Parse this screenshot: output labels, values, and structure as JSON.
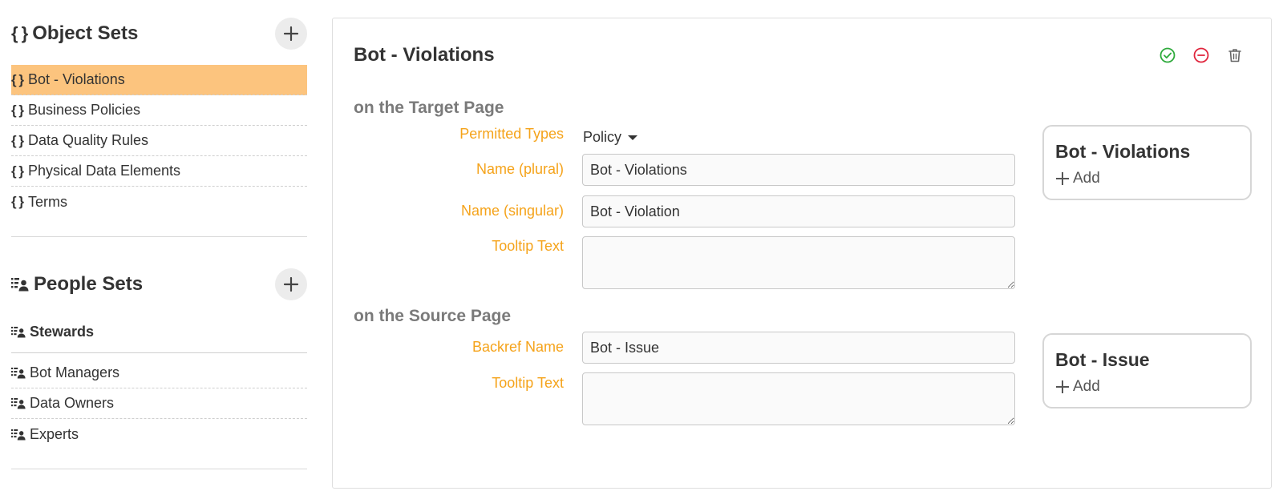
{
  "object_sets": {
    "title": "Object Sets",
    "title_glyph": "{ }",
    "items": [
      {
        "label": "Bot - Violations",
        "selected": true
      },
      {
        "label": "Business Policies"
      },
      {
        "label": "Data Quality Rules"
      },
      {
        "label": "Physical Data Elements"
      },
      {
        "label": "Terms"
      }
    ]
  },
  "people_sets": {
    "title": "People Sets",
    "group": "Stewards",
    "items": [
      {
        "label": "Bot Managers"
      },
      {
        "label": "Data Owners"
      },
      {
        "label": "Experts"
      }
    ]
  },
  "editor": {
    "title": "Bot - Violations",
    "actions": [
      {
        "icon": "check-circle-icon",
        "color": "#2eaa3c"
      },
      {
        "icon": "minus-circle-icon",
        "color": "#e0243c"
      },
      {
        "icon": "trash-icon",
        "color": "#666666"
      }
    ],
    "target": {
      "heading": "on the Target Page",
      "permitted_types_label": "Permitted Types",
      "permitted_types_value": "Policy",
      "name_plural_label": "Name (plural)",
      "name_plural_value": "Bot - Violations",
      "name_singular_label": "Name (singular)",
      "name_singular_value": "Bot - Violation",
      "tooltip_label": "Tooltip Text",
      "tooltip_value": "",
      "preview_title": "Bot - Violations",
      "preview_add": "Add"
    },
    "source": {
      "heading": "on the Source Page",
      "backref_label": "Backref Name",
      "backref_value": "Bot - Issue",
      "tooltip_label": "Tooltip Text",
      "tooltip_value": "",
      "preview_title": "Bot - Issue",
      "preview_add": "Add"
    }
  },
  "colors": {
    "selected_bg": "#fcc47e",
    "label_accent": "#f5a31a"
  }
}
